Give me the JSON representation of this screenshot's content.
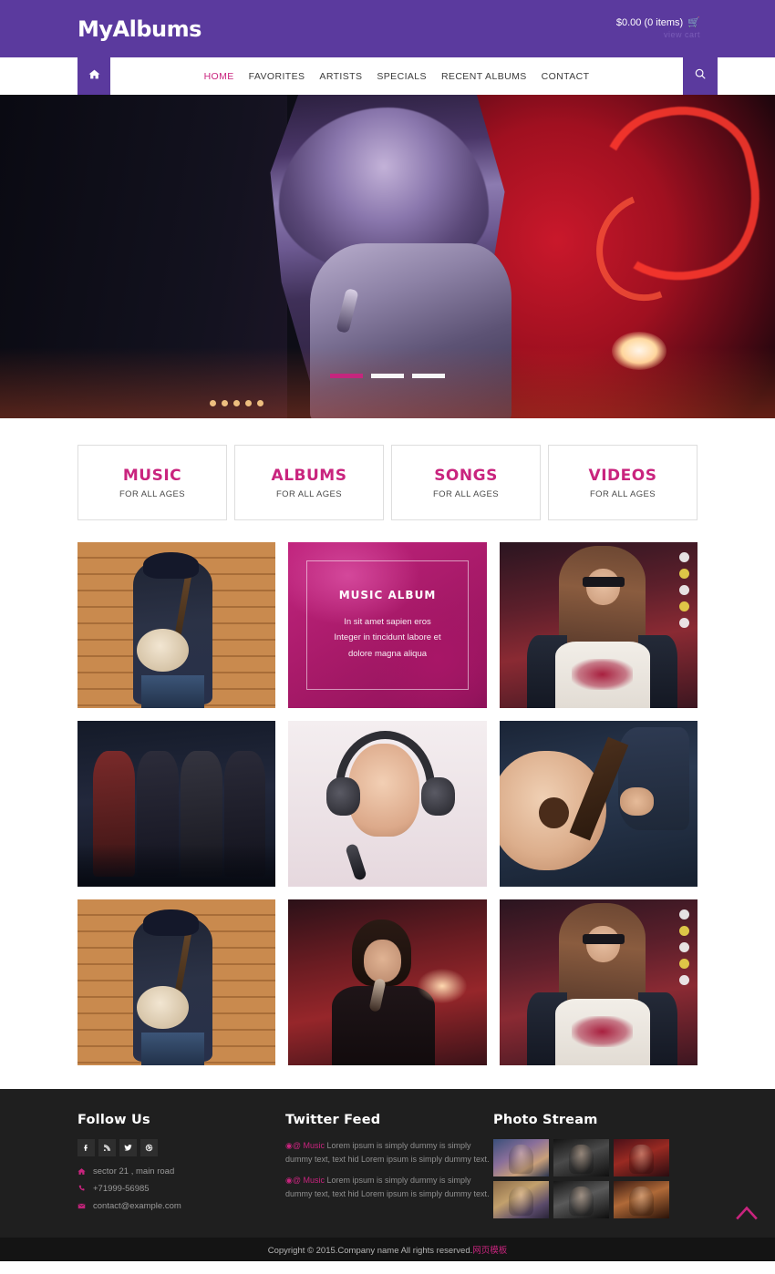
{
  "header": {
    "logo": "MyAlbums",
    "cart_text": "$0.00 (0 items)",
    "cart_icon": "shopping-cart-icon",
    "cart_sub": "view cart"
  },
  "nav": {
    "home_icon": "home-icon",
    "search_icon": "search-icon",
    "items": [
      {
        "label": "HOME",
        "active": true
      },
      {
        "label": "FAVORITES",
        "active": false
      },
      {
        "label": "ARTISTS",
        "active": false
      },
      {
        "label": "SPECIALS",
        "active": false
      },
      {
        "label": "RECENT ALBUMS",
        "active": false
      },
      {
        "label": "CONTACT",
        "active": false
      }
    ]
  },
  "hero": {
    "slides": [
      {
        "name": "slider-dot-1",
        "active": true
      },
      {
        "name": "slider-dot-2",
        "active": false
      },
      {
        "name": "slider-dot-3",
        "active": false
      }
    ]
  },
  "categories": [
    {
      "title": "MUSIC",
      "subtitle": "FOR ALL AGES"
    },
    {
      "title": "ALBUMS",
      "subtitle": "FOR ALL AGES"
    },
    {
      "title": "SONGS",
      "subtitle": "FOR ALL AGES"
    },
    {
      "title": "VIDEOS",
      "subtitle": "FOR ALL AGES"
    }
  ],
  "gallery": {
    "album_card": {
      "title": "MUSIC ALBUM",
      "line1": "In sit amet sapien eros",
      "line2": "Integer in tincidunt labore et",
      "line3": "dolore magna aliqua"
    },
    "tiles": [
      {
        "name": "gallery-tile-banjo-player"
      },
      {
        "name": "gallery-tile-music-album"
      },
      {
        "name": "gallery-tile-woman-sunglasses"
      },
      {
        "name": "gallery-tile-band-on-stage"
      },
      {
        "name": "gallery-tile-woman-headphones"
      },
      {
        "name": "gallery-tile-acoustic-guitar"
      },
      {
        "name": "gallery-tile-banjo-player-2"
      },
      {
        "name": "gallery-tile-male-singer"
      },
      {
        "name": "gallery-tile-woman-sunglasses-2"
      }
    ]
  },
  "footer": {
    "follow": {
      "title": "Follow Us",
      "social": [
        {
          "name": "facebook-icon",
          "label": "f"
        },
        {
          "name": "rss-icon",
          "label": "rss"
        },
        {
          "name": "twitter-icon",
          "label": "twitter"
        },
        {
          "name": "dribbble-icon",
          "label": "dribbble"
        }
      ],
      "address": "sector 21 , main road",
      "phone": "+71999-56985",
      "email": "contact@example.com"
    },
    "twitter": {
      "title": "Twitter Feed",
      "tweets": [
        {
          "handle": "@ Music",
          "text": " Lorem ipsum is simply dummy is simply dummy text, text hid Lorem ipsum is simply dummy text."
        },
        {
          "handle": "@ Music",
          "text": " Lorem ipsum is simply dummy is simply dummy text, text hid Lorem ipsum is simply dummy text."
        }
      ]
    },
    "photo_stream": {
      "title": "Photo Stream",
      "thumbs": [
        {
          "name": "photo-thumb-1"
        },
        {
          "name": "photo-thumb-2"
        },
        {
          "name": "photo-thumb-3"
        },
        {
          "name": "photo-thumb-4"
        },
        {
          "name": "photo-thumb-5"
        },
        {
          "name": "photo-thumb-6"
        }
      ]
    },
    "copyright": "Copyright © 2015.Company name All rights reserved.",
    "copyright_cn": "网页模板",
    "to_top_icon": "chevron-up-icon"
  },
  "colors": {
    "purple": "#5b3a9e",
    "pink": "#c9247e",
    "footer_bg": "#1f1f1f",
    "copyright_bg": "#141414"
  }
}
